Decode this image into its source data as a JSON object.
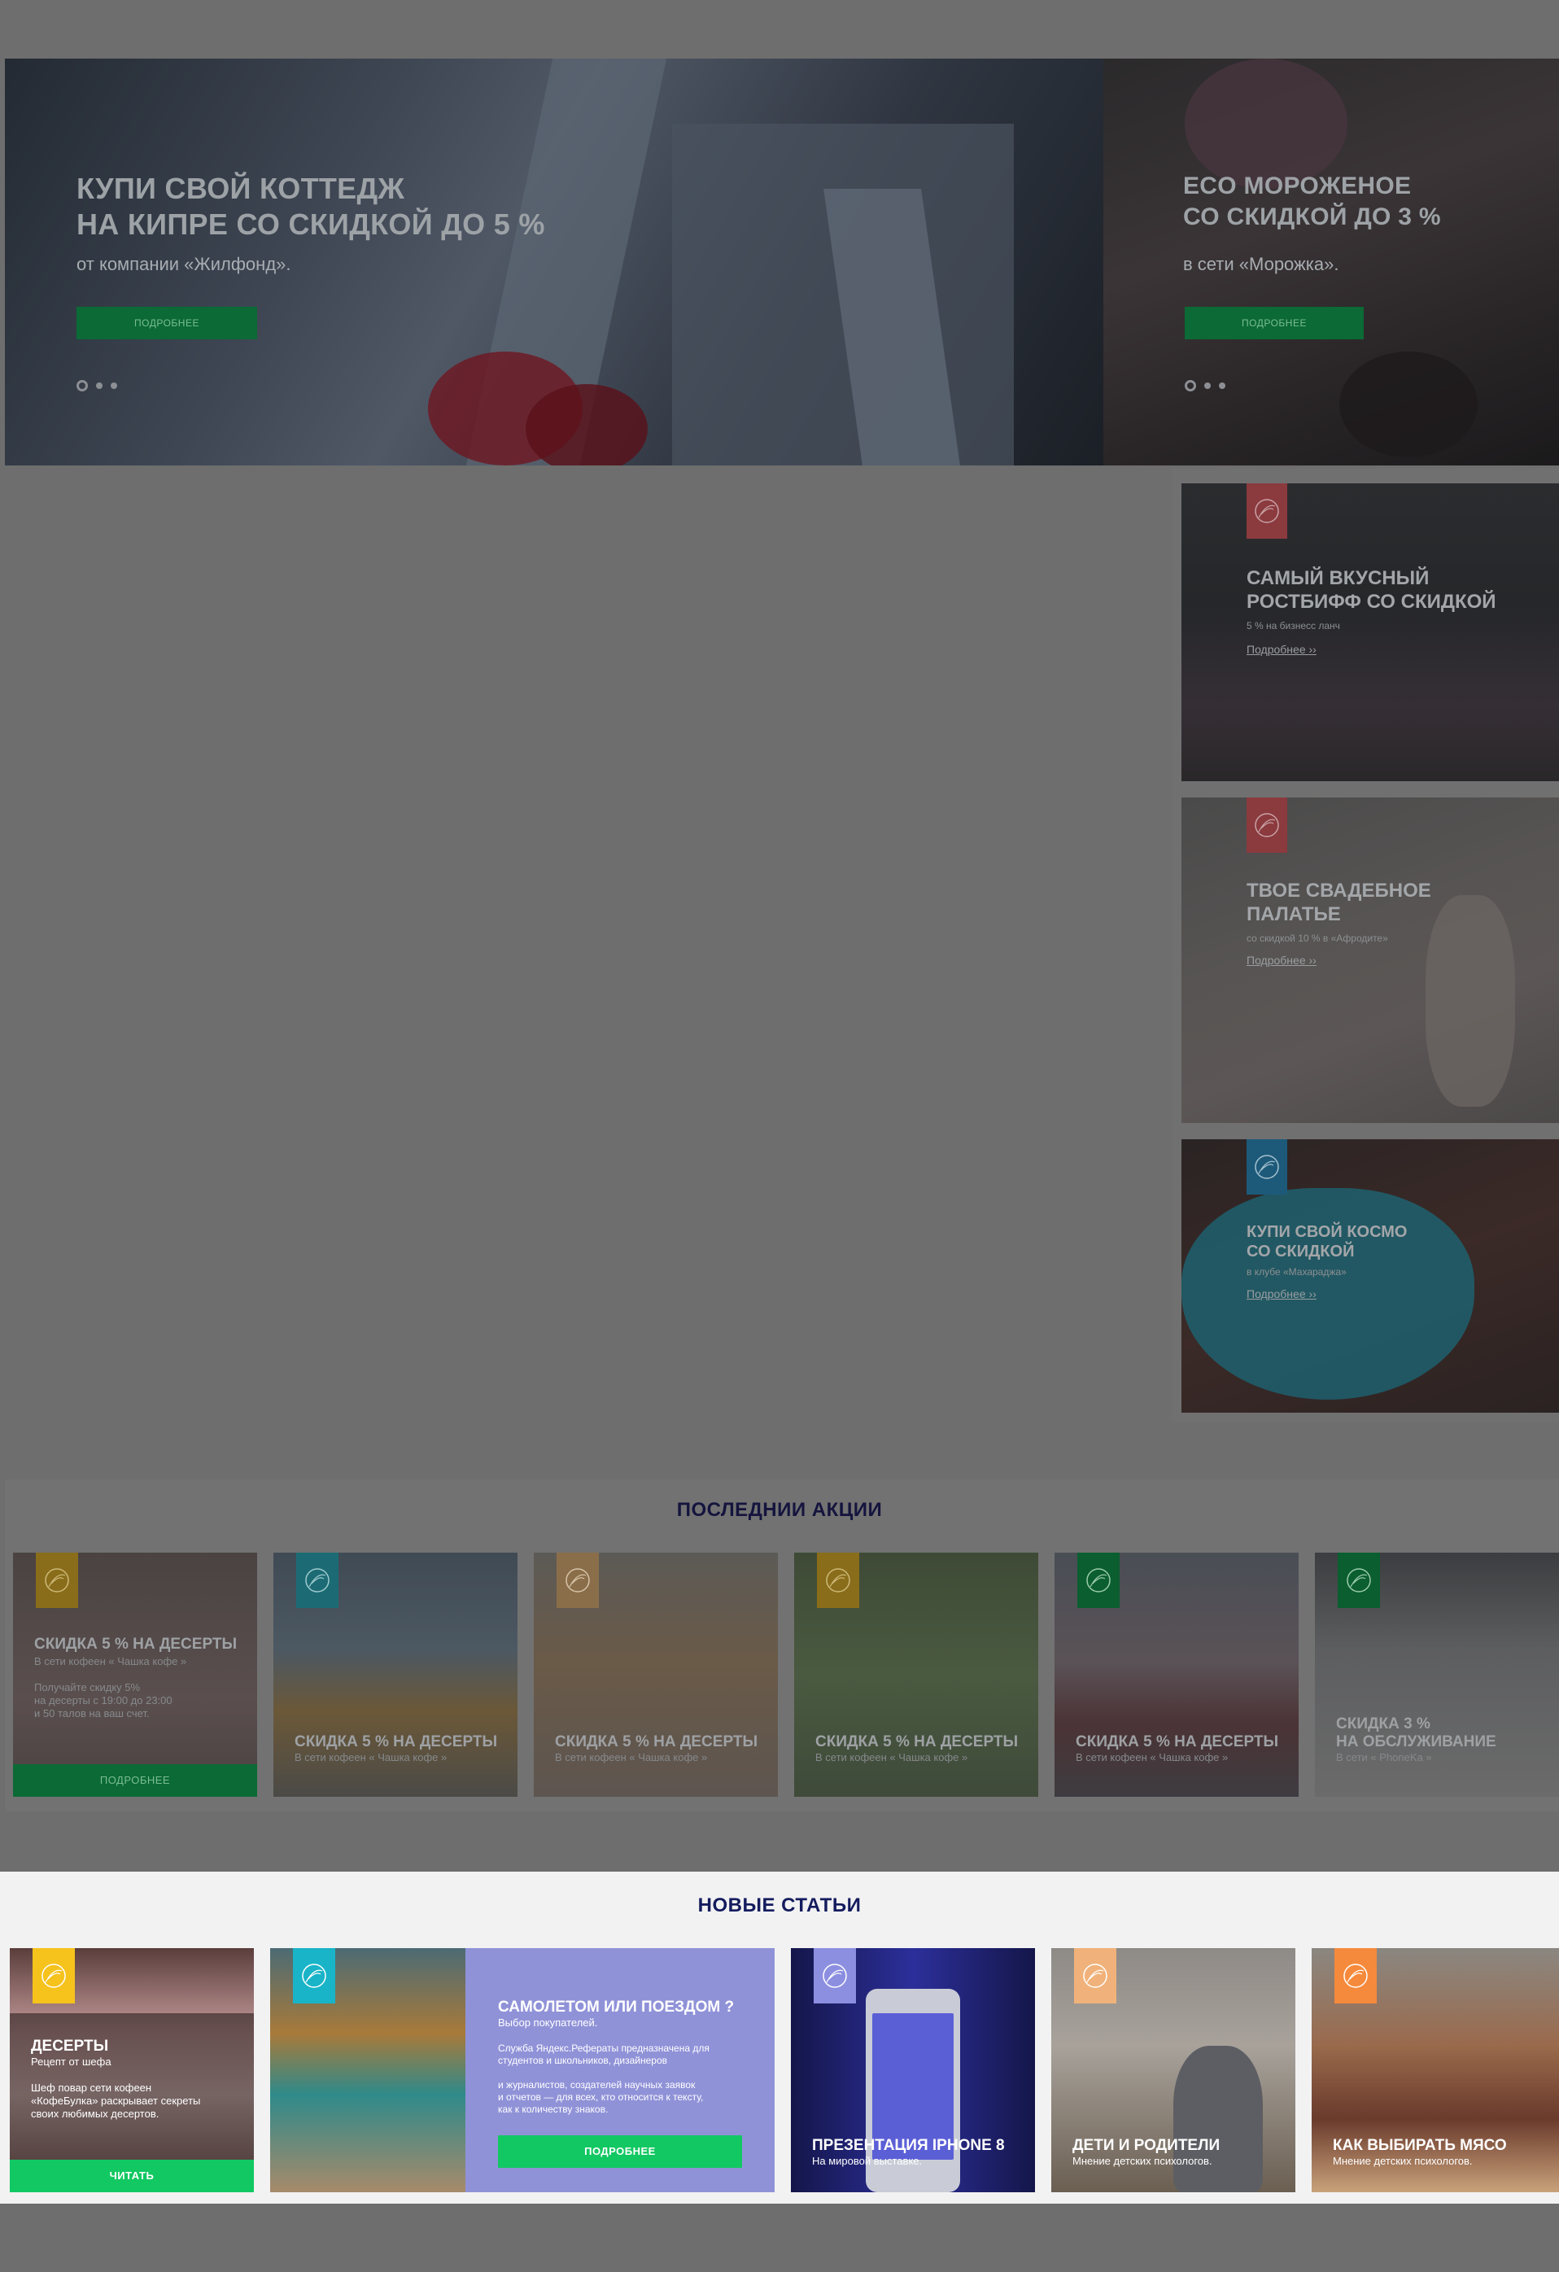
{
  "hero": {
    "slides": [
      {
        "title": "КУПИ СВОЙ КОТТЕДЖ\nНА КИПРЕ СО СКИДКОЙ ДО 5 %",
        "subtitle": "от компании «Жилфонд».",
        "button": "ПОДРОБНЕЕ"
      },
      {
        "title": "ECO МОРОЖЕНОЕ\nСО СКИДКОЙ ДО 3 %",
        "subtitle": "в сети «Морожка».",
        "button": "ПОДРОБНЕЕ"
      }
    ]
  },
  "side_promos": [
    {
      "title": "САМЫЙ ВКУСНЫЙ\nРОСТБИФФ СО СКИДКОЙ",
      "subtitle": "5 % на бизнесс ланч",
      "link": "Подробнее ››",
      "tag_color": "#8b3a3e"
    },
    {
      "title": "ТВОЕ СВАДЕБНОЕ\nПАЛАТЬЕ",
      "subtitle": "со скидкой 10 % в «Афродите»",
      "link": "Подробнее ››",
      "tag_color": "#8b3a3e"
    },
    {
      "title": "КУПИ СВОЙ КОСМО\nСО СКИДКОЙ",
      "subtitle": "в клубе «Махараджа»",
      "link": "Подробнее ››",
      "tag_color": "#1d5a7a"
    }
  ],
  "latest_actions": {
    "heading": "ПОСЛЕДНИИ АКЦИИ",
    "cards": [
      {
        "title": "СКИДКА 5 % НА ДЕСЕРТЫ",
        "subtitle": "В сети кофеен « Чашка кофе »",
        "body": "Получайте скидку  5%\nна десерты с 19:00 до 23:00\nи 50 талов на ваш счет.",
        "button": "ПОДРОБНЕЕ",
        "tag_color": "#8a6d1a"
      },
      {
        "title": "СКИДКА 5 % НА ДЕСЕРТЫ",
        "subtitle": "В сети кофеен « Чашка кофе »",
        "tag_color": "#1c6b74"
      },
      {
        "title": "СКИДКА 5 % НА ДЕСЕРТЫ",
        "subtitle": "В сети кофеен « Чашка кофе »",
        "tag_color": "#8a6e4a"
      },
      {
        "title": "СКИДКА 5 % НА ДЕСЕРТЫ",
        "subtitle": "В сети кофеен « Чашка кофе »",
        "tag_color": "#8a6d1a"
      },
      {
        "title": "СКИДКА 5 % НА ДЕСЕРТЫ",
        "subtitle": "В сети кофеен « Чашка кофе »",
        "tag_color": "#0b5e2f"
      },
      {
        "title": "СКИДКА 3 %\nНА ОБСЛУЖИВАНИЕ",
        "subtitle": "В сети « PhoneKa »",
        "tag_color": "#0b5e2f"
      }
    ]
  },
  "new_articles": {
    "heading": "НОВЫЕ СТАТЬИ",
    "cards": [
      {
        "title": "ДЕСЕРТЫ",
        "subtitle": "Рецепт от шефа",
        "body": "Шеф повар сети кофеен\n«КофеБулка» раскрывает секреты\nсвоих любимых десертов.",
        "button": "ЧИТАТЬ",
        "tag_color": "#f6c21c"
      },
      {
        "title": "САМОЛЕТОМ ИЛИ ПОЕЗДОМ ?",
        "subtitle": "Выбор покупателей.",
        "body": "Служба Яндекс.Рефераты предназначена для\nстудентов и школьников, дизайнеров\n\nи журналистов, создателей научных заявок\nи отчетов — для всех, кто относится к тексту,\nкак к количеству знаков.",
        "button": "ПОДРОБНЕЕ",
        "tag_color": "#19b4c8"
      },
      {
        "title": "ПРЕЗЕНТАЦИЯ IPHONE 8",
        "subtitle": "На мировой выставке.",
        "tag_color": "#8c8fe0"
      },
      {
        "title": "ДЕТИ И РОДИТЕЛИ",
        "subtitle": "Мнение детских психологов.",
        "tag_color": "#f0b27a"
      },
      {
        "title": "КАК ВЫБИРАТЬ МЯСО",
        "subtitle": "Мнение детских психологов.",
        "tag_color": "#f58a3c"
      }
    ]
  }
}
